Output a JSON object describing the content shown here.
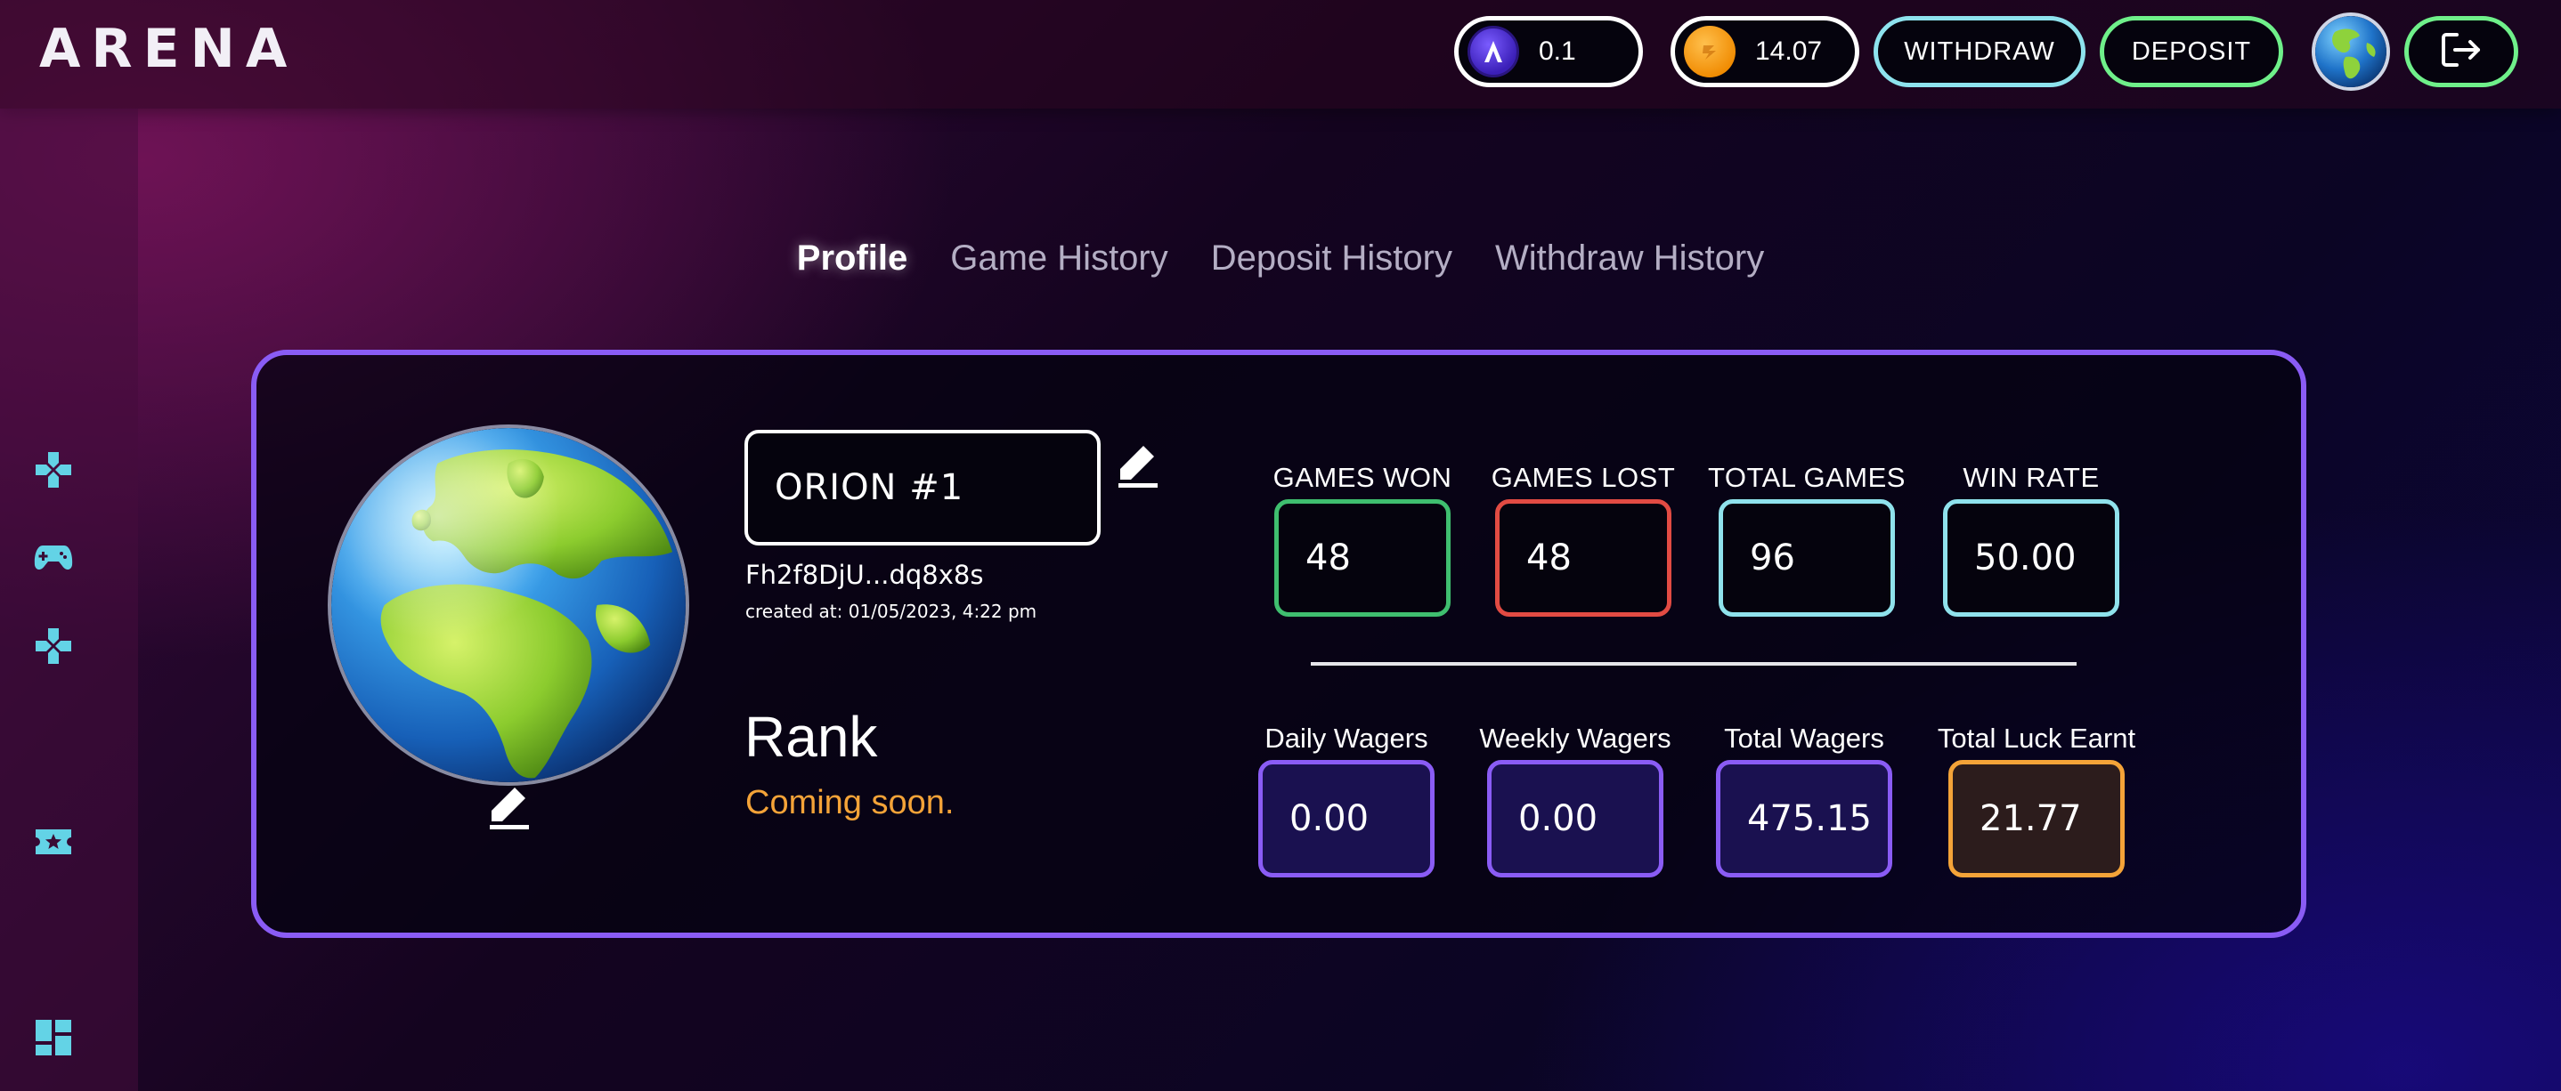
{
  "header": {
    "logo": "ARENA",
    "luck_balance": "0.1",
    "sol_balance": "14.07",
    "withdraw_label": "WITHDRAW",
    "deposit_label": "DEPOSIT",
    "icons": [
      "luck-token-icon",
      "sol-coin-icon",
      "avatar-globe",
      "logout-icon"
    ]
  },
  "sidebar": {
    "items": [
      {
        "icon": "dpad-icon"
      },
      {
        "icon": "gamepad-icon"
      },
      {
        "icon": "dpad-icon"
      },
      {
        "icon": "ticket-star-icon"
      },
      {
        "icon": "dashboard-icon"
      }
    ]
  },
  "tabs": [
    {
      "label": "Profile",
      "active": true
    },
    {
      "label": "Game History",
      "active": false
    },
    {
      "label": "Deposit History",
      "active": false
    },
    {
      "label": "Withdraw History",
      "active": false
    }
  ],
  "profile": {
    "username": "ORION #1",
    "wallet": "Fh2f8DjU...dq8x8s",
    "created_at": "created at: 01/05/2023, 4:22 pm",
    "rank_title": "Rank",
    "rank_status": "Coming soon."
  },
  "stats": {
    "games_won": {
      "label": "GAMES WON",
      "value": "48",
      "color": "#3fbf6f"
    },
    "games_lost": {
      "label": "GAMES LOST",
      "value": "48",
      "color": "#e24b43"
    },
    "total_games": {
      "label": "TOTAL GAMES",
      "value": "96",
      "color": "#8fe2ec"
    },
    "win_rate": {
      "label": "WIN RATE",
      "value": "50.00",
      "color": "#8fe2ec"
    },
    "daily_wagers": {
      "label": "Daily Wagers",
      "value": "0.00",
      "color": "#8a5cf5"
    },
    "weekly_wagers": {
      "label": "Weekly Wagers",
      "value": "0.00",
      "color": "#8a5cf5"
    },
    "total_wagers": {
      "label": "Total Wagers",
      "value": "475.15",
      "color": "#8a5cf5"
    },
    "total_luck": {
      "label": "Total Luck Earnt",
      "value": "21.77",
      "color": "#f4a338"
    }
  },
  "colors": {
    "accent_purple": "#8a5cf5",
    "accent_cyan": "#8ee3ee",
    "accent_green": "#6ff08a",
    "accent_orange": "#f4a338"
  }
}
